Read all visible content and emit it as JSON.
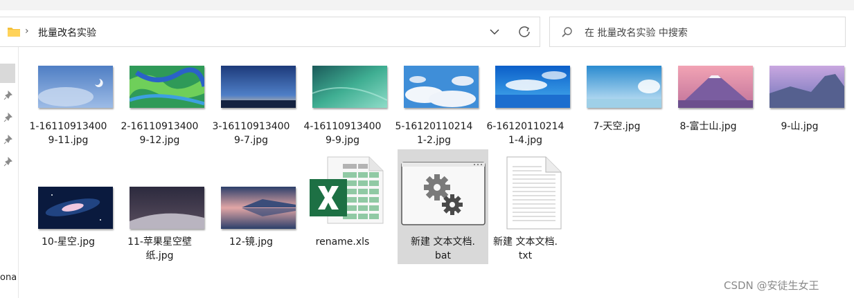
{
  "address_bar": {
    "path": "批量改名实验"
  },
  "search": {
    "placeholder": "在 批量改名实验 中搜索"
  },
  "nav": {
    "partial_label": "ona"
  },
  "files": [
    {
      "name": "1-161109134009-11.jpg",
      "line1": "1-16110913400",
      "line2": "9-11.jpg",
      "type": "image"
    },
    {
      "name": "2-161109134009-12.jpg",
      "line1": "2-16110913400",
      "line2": "9-12.jpg",
      "type": "image"
    },
    {
      "name": "3-161109134009-7.jpg",
      "line1": "3-16110913400",
      "line2": "9-7.jpg",
      "type": "image"
    },
    {
      "name": "4-161109134009-9.jpg",
      "line1": "4-16110913400",
      "line2": "9-9.jpg",
      "type": "image"
    },
    {
      "name": "5-161201102141-2.jpg",
      "line1": "5-16120110214",
      "line2": "1-2.jpg",
      "type": "image"
    },
    {
      "name": "6-161201102141-4.jpg",
      "line1": "6-16120110214",
      "line2": "1-4.jpg",
      "type": "image"
    },
    {
      "name": "7-天空.jpg",
      "line1": "7-天空.jpg",
      "line2": "",
      "type": "image"
    },
    {
      "name": "8-富士山.jpg",
      "line1": "8-富士山.jpg",
      "line2": "",
      "type": "image"
    },
    {
      "name": "9-山.jpg",
      "line1": "9-山.jpg",
      "line2": "",
      "type": "image"
    },
    {
      "name": "10-星空.jpg",
      "line1": "10-星空.jpg",
      "line2": "",
      "type": "image"
    },
    {
      "name": "11-苹果星空壁纸.jpg",
      "line1": "11-苹果星空壁",
      "line2": "纸.jpg",
      "type": "image"
    },
    {
      "name": "12-镜.jpg",
      "line1": "12-镜.jpg",
      "line2": "",
      "type": "image"
    },
    {
      "name": "rename.xls",
      "line1": "rename.xls",
      "line2": "",
      "type": "excel"
    },
    {
      "name": "新建 文本文档.bat",
      "line1": "新建 文本文档.",
      "line2": "bat",
      "type": "batch",
      "selected": true
    },
    {
      "name": "新建 文本文档.txt",
      "line1": "新建 文本文档.",
      "line2": "txt",
      "type": "text"
    }
  ],
  "watermark": "CSDN @安徒生女王",
  "colors": {
    "selection": "#d9d9d9",
    "folder": "#f4c03a",
    "excel_green": "#1d7044"
  }
}
